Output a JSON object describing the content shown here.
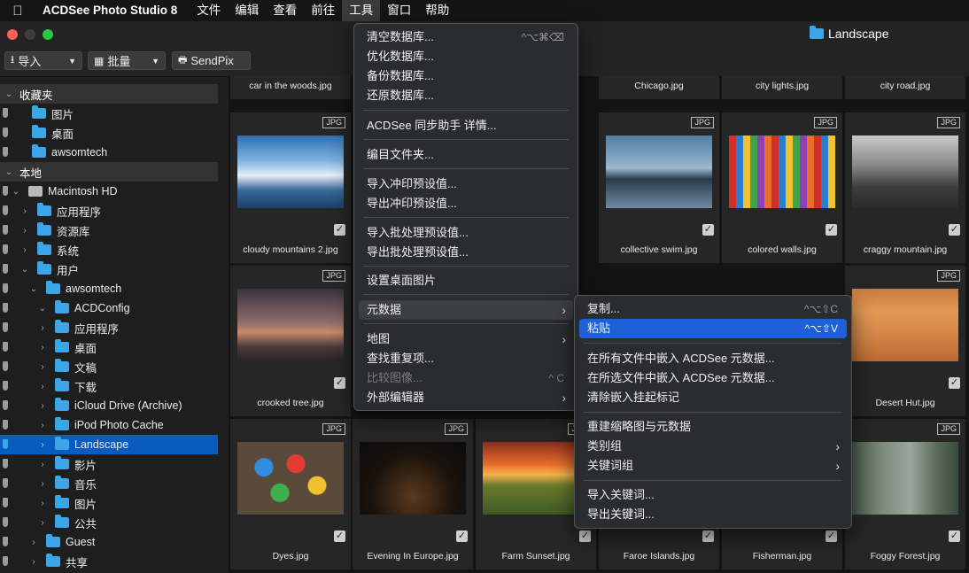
{
  "menubar": {
    "app_name": "ACDSee Photo Studio 8",
    "items": [
      "文件",
      "编辑",
      "查看",
      "前往",
      "工具",
      "窗口",
      "帮助"
    ]
  },
  "window": {
    "title": "Landscape"
  },
  "toolbar": {
    "import": "导入",
    "batch": "批量",
    "sendpix": "SendPix"
  },
  "sidebar": {
    "favorites": "收藏夹",
    "fav_items": [
      "图片",
      "桌面",
      "awsomtech"
    ],
    "local": "本地",
    "mac_hd": "Macintosh HD",
    "top_folders": [
      "应用程序",
      "资源库",
      "系统",
      "用户"
    ],
    "user": "awsomtech",
    "user_folders": [
      "ACDConfig",
      "应用程序",
      "桌面",
      "文稿",
      "下载",
      "iCloud Drive (Archive)",
      "iPod Photo Cache",
      "Landscape",
      "影片",
      "音乐",
      "图片",
      "公共"
    ],
    "other": [
      "Guest",
      "共享"
    ]
  },
  "grid": {
    "badge": "JPG",
    "row0": [
      "car in the woods.jpg",
      "",
      "Chicago.jpg",
      "city lights.jpg",
      "city road.jpg",
      "",
      ""
    ],
    "row1": [
      "cloudy mountains 2.jpg",
      "",
      "",
      "collective swim.jpg",
      "colored walls.jpg",
      "craggy mountain.jpg"
    ],
    "row2": [
      "crooked tree.jpg",
      "",
      "",
      "",
      "",
      "Desert Hut.jpg"
    ],
    "row3": [
      "Dyes.jpg",
      "Evening In Europe.jpg",
      "Farm Sunset.jpg",
      "Faroe Islands.jpg",
      "Fisherman.jpg",
      "Foggy Forest.jpg"
    ]
  },
  "tools_menu": {
    "clear_db": "清空数据库...",
    "clear_db_sc": "^⌥⌘⌫",
    "optimize_db": "优化数据库...",
    "backup_db": "备份数据库...",
    "restore_db": "还原数据库...",
    "sync": "ACDSee 同步助手 详情...",
    "catalog": "编目文件夹...",
    "import_print": "导入冲印预设值...",
    "export_print": "导出冲印预设值...",
    "import_batch": "导入批处理预设值...",
    "export_batch": "导出批处理预设值...",
    "wallpaper": "设置桌面图片",
    "metadata": "元数据",
    "map": "地图",
    "dupes": "查找重复项...",
    "compare": "比较图像...",
    "compare_sc": "^ C",
    "external": "外部编辑器"
  },
  "metadata_menu": {
    "copy": "复制...",
    "copy_sc": "^⌥⇧C",
    "paste": "粘贴",
    "paste_sc": "^⌥⇧V",
    "embed_all": "在所有文件中嵌入 ACDSee 元数据...",
    "embed_selected": "在所选文件中嵌入 ACDSee 元数据...",
    "clear_flags": "清除嵌入挂起标记",
    "rebuild": "重建缩略图与元数据",
    "categories": "类别组",
    "keywords": "关键词组",
    "import_kw": "导入关键词...",
    "export_kw": "导出关键词..."
  },
  "colors": {
    "accent": "#1f5fd8",
    "folder": "#3ba5e8",
    "selection": "#0a5bc0"
  }
}
